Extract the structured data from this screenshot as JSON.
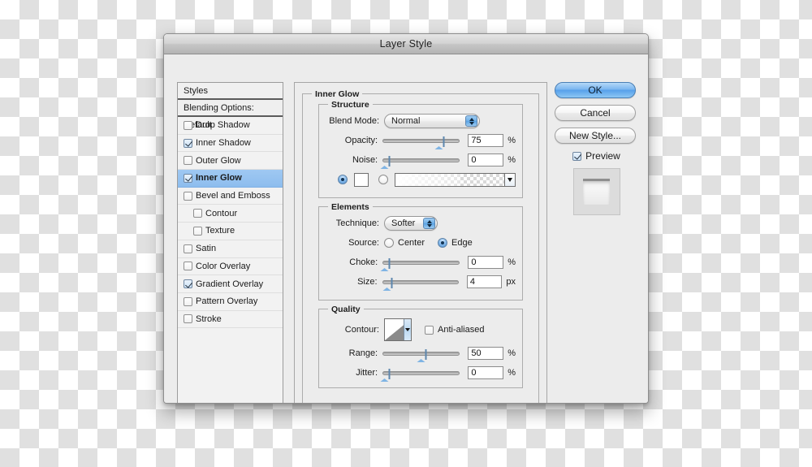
{
  "dialog": {
    "title": "Layer Style"
  },
  "sidebar": {
    "header": "Styles",
    "blending_options": "Blending Options: Default",
    "items": [
      {
        "label": "Drop Shadow",
        "checked": false,
        "selected": false,
        "indent": false
      },
      {
        "label": "Inner Shadow",
        "checked": true,
        "selected": false,
        "indent": false
      },
      {
        "label": "Outer Glow",
        "checked": false,
        "selected": false,
        "indent": false
      },
      {
        "label": "Inner Glow",
        "checked": true,
        "selected": true,
        "indent": false
      },
      {
        "label": "Bevel and Emboss",
        "checked": false,
        "selected": false,
        "indent": false
      },
      {
        "label": "Contour",
        "checked": false,
        "selected": false,
        "indent": true
      },
      {
        "label": "Texture",
        "checked": false,
        "selected": false,
        "indent": true
      },
      {
        "label": "Satin",
        "checked": false,
        "selected": false,
        "indent": false
      },
      {
        "label": "Color Overlay",
        "checked": false,
        "selected": false,
        "indent": false
      },
      {
        "label": "Gradient Overlay",
        "checked": true,
        "selected": false,
        "indent": false
      },
      {
        "label": "Pattern Overlay",
        "checked": false,
        "selected": false,
        "indent": false
      },
      {
        "label": "Stroke",
        "checked": false,
        "selected": false,
        "indent": false
      }
    ]
  },
  "buttons": {
    "ok": "OK",
    "cancel": "Cancel",
    "new_style": "New Style...",
    "preview_label": "Preview",
    "preview_checked": true
  },
  "panel": {
    "title": "Inner Glow",
    "structure": {
      "title": "Structure",
      "blend_mode_label": "Blend Mode:",
      "blend_mode_value": "Normal",
      "opacity_label": "Opacity:",
      "opacity_value": "75",
      "opacity_unit": "%",
      "opacity_percent": 75,
      "noise_label": "Noise:",
      "noise_value": "0",
      "noise_unit": "%",
      "noise_percent": 0,
      "fill_type": "color",
      "color_swatch": "#ffffff"
    },
    "elements": {
      "title": "Elements",
      "technique_label": "Technique:",
      "technique_value": "Softer",
      "source_label": "Source:",
      "source_center": "Center",
      "source_edge": "Edge",
      "source_value": "Edge",
      "choke_label": "Choke:",
      "choke_value": "0",
      "choke_unit": "%",
      "choke_percent": 0,
      "size_label": "Size:",
      "size_value": "4",
      "size_unit": "px",
      "size_percent": 4
    },
    "quality": {
      "title": "Quality",
      "contour_label": "Contour:",
      "anti_aliased_label": "Anti-aliased",
      "anti_aliased_checked": false,
      "range_label": "Range:",
      "range_value": "50",
      "range_unit": "%",
      "range_percent": 50,
      "jitter_label": "Jitter:",
      "jitter_value": "0",
      "jitter_unit": "%",
      "jitter_percent": 0
    }
  }
}
